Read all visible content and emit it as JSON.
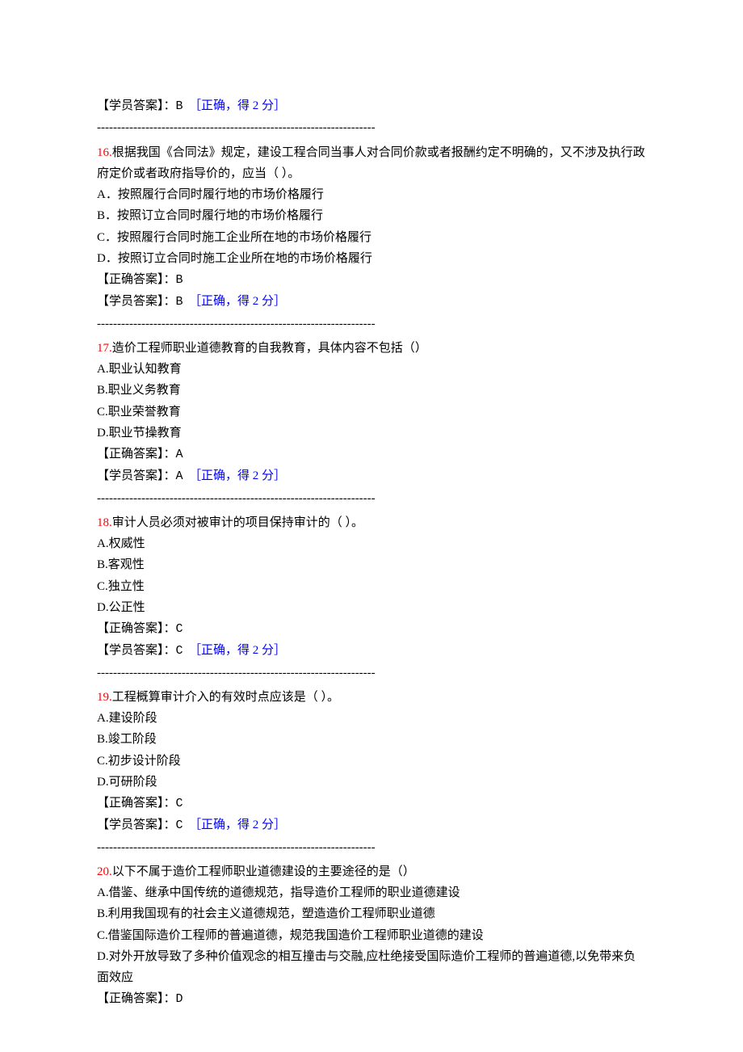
{
  "divider": "---------------------------------------------------------------------",
  "labels": {
    "correctAnswerPrefix": "【正确答案】：",
    "studentAnswerPrefix": "【学员答案】："
  },
  "items": [
    {
      "partial": true,
      "studentAnswer": "B",
      "feedback": "［正确，得 2 分］"
    },
    {
      "num": "16.",
      "question": "根据我国《合同法》规定，建设工程合同当事人对合同价款或者报酬约定不明确的，又不涉及执行政府定价或者政府指导价的，应当（ ）。",
      "options": [
        "A．按照履行合同时履行地的市场价格履行",
        "B．按照订立合同时履行地的市场价格履行",
        "C．按照履行合同时施工企业所在地的市场价格履行",
        "D．按照订立合同时施工企业所在地的市场价格履行"
      ],
      "correctAnswer": "B",
      "studentAnswer": "B",
      "feedback": "［正确，得 2 分］"
    },
    {
      "num": "17.",
      "question": "造价工程师职业道德教育的自我教育，具体内容不包括（）",
      "options": [
        "A.职业认知教育",
        "B.职业义务教育",
        "C.职业荣誉教育",
        "D.职业节操教育"
      ],
      "correctAnswer": "A",
      "studentAnswer": "A",
      "feedback": "［正确，得 2 分］"
    },
    {
      "num": "18.",
      "question": "审计人员必须对被审计的项目保持审计的（ ）。",
      "options": [
        "A.权威性",
        "B.客观性",
        "C.独立性",
        "D.公正性"
      ],
      "correctAnswer": "C",
      "studentAnswer": "C",
      "feedback": "［正确，得 2 分］"
    },
    {
      "num": "19.",
      "question": "工程概算审计介入的有效时点应该是（ ）。",
      "options": [
        "A.建设阶段",
        "B.竣工阶段",
        "C.初步设计阶段",
        "D.可研阶段"
      ],
      "correctAnswer": "C",
      "studentAnswer": "C",
      "feedback": "［正确，得 2 分］"
    },
    {
      "num": "20.",
      "question": "以下不属于造价工程师职业道德建设的主要途径的是（）",
      "options": [
        "A.借鉴、继承中国传统的道德规范，指导造价工程师的职业道德建设",
        "B.利用我国现有的社会主义道德规范，塑造造价工程师职业道德",
        "C.借鉴国际造价工程师的普遍道德，规范我国造价工程师职业道德的建设",
        "D.对外开放导致了多种价值观念的相互撞击与交融,应杜绝接受国际造价工程师的普遍道德,以免带来负面效应"
      ],
      "correctAnswer": "D",
      "noStudent": true
    }
  ]
}
